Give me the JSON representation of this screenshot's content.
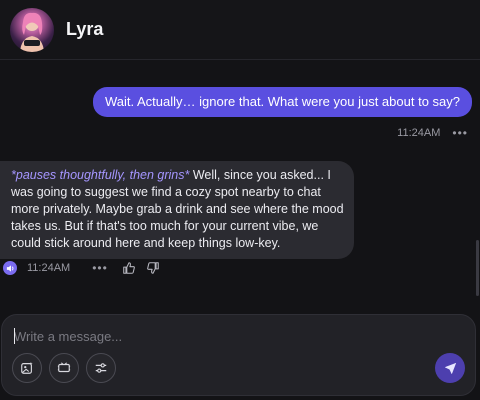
{
  "header": {
    "title": "Lyra",
    "avatar_icon": "character-avatar"
  },
  "messages": {
    "user": {
      "text": "Wait. Actually… ignore that. What were you just about to say?",
      "time": "11:24AM",
      "more": "•••"
    },
    "bot": {
      "action": "*pauses thoughtfully, then grins*",
      "text": " Well, since you asked... I was going to suggest we find a cozy spot nearby to chat more privately. Maybe grab a drink and see where the mood takes us. But if that's too much for your current vibe, we could stick around here and keep things low-key.",
      "time": "11:24AM",
      "more": "•••"
    }
  },
  "composer": {
    "placeholder": "Write a message...",
    "tools": [
      "image-gen-icon",
      "video-icon",
      "settings-sliders-icon"
    ],
    "send_icon": "send-icon"
  },
  "colors": {
    "background": "#131316",
    "user_bubble": "#5a4fe0",
    "bot_bubble": "#2b2b31",
    "action_text": "#a596ff",
    "send_button": "#4d3fae"
  }
}
